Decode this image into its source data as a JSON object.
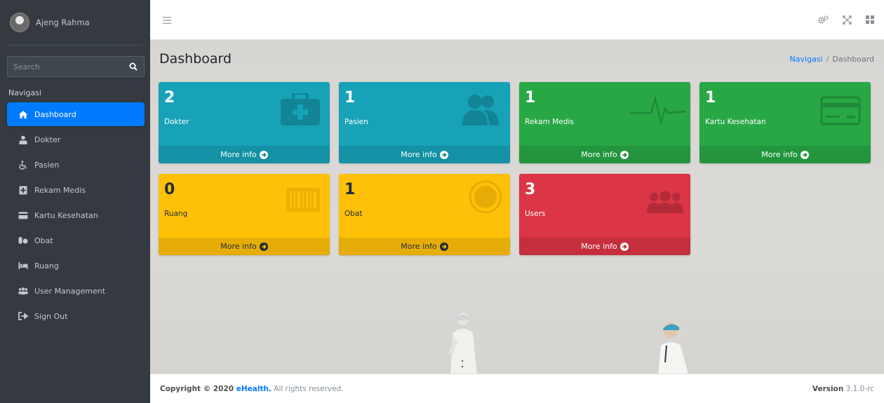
{
  "sidebar": {
    "user_name": "Ajeng Rahma",
    "search_placeholder": "Search",
    "nav_header": "Navigasi",
    "items": [
      {
        "label": "Dashboard",
        "icon": "home-icon",
        "active": true
      },
      {
        "label": "Dokter",
        "icon": "doctor-icon"
      },
      {
        "label": "Pasien",
        "icon": "wheelchair-icon"
      },
      {
        "label": "Rekam Medis",
        "icon": "medical-record-icon"
      },
      {
        "label": "Kartu Kesehatan",
        "icon": "card-icon"
      },
      {
        "label": "Obat",
        "icon": "pills-icon"
      },
      {
        "label": "Ruang",
        "icon": "bed-icon"
      },
      {
        "label": "User Management",
        "icon": "users-icon"
      },
      {
        "label": "Sign Out",
        "icon": "sign-out-icon"
      }
    ]
  },
  "page": {
    "title": "Dashboard",
    "breadcrumb": [
      "Navigasi",
      "Dashboard"
    ]
  },
  "boxes": [
    {
      "count": "2",
      "label": "Dokter",
      "footer": "More info",
      "color": "#17a2b8",
      "icon": "medkit-icon"
    },
    {
      "count": "1",
      "label": "Pasien",
      "footer": "More info",
      "color": "#17a2b8",
      "icon": "users-icon"
    },
    {
      "count": "1",
      "label": "Rekam Medis",
      "footer": "More info",
      "color": "#28a745",
      "icon": "heartbeat-icon"
    },
    {
      "count": "1",
      "label": "Kartu Kesehatan",
      "footer": "More info",
      "color": "#28a745",
      "icon": "credit-card-icon"
    },
    {
      "count": "0",
      "label": "Ruang",
      "footer": "More info",
      "color": "#ffc107",
      "icon": "barcode-icon"
    },
    {
      "count": "1",
      "label": "Obat",
      "footer": "More info",
      "color": "#ffc107",
      "icon": "circle-icon"
    },
    {
      "count": "3",
      "label": "Users",
      "footer": "More info",
      "color": "#dc3545",
      "icon": "users-icon"
    }
  ],
  "footer": {
    "copyright_prefix": "Copyright © 2020 ",
    "brand": "eHealth.",
    "copyright_suffix": " All rights reserved.",
    "version_label": "Version",
    "version": " 3.1.0-rc"
  }
}
